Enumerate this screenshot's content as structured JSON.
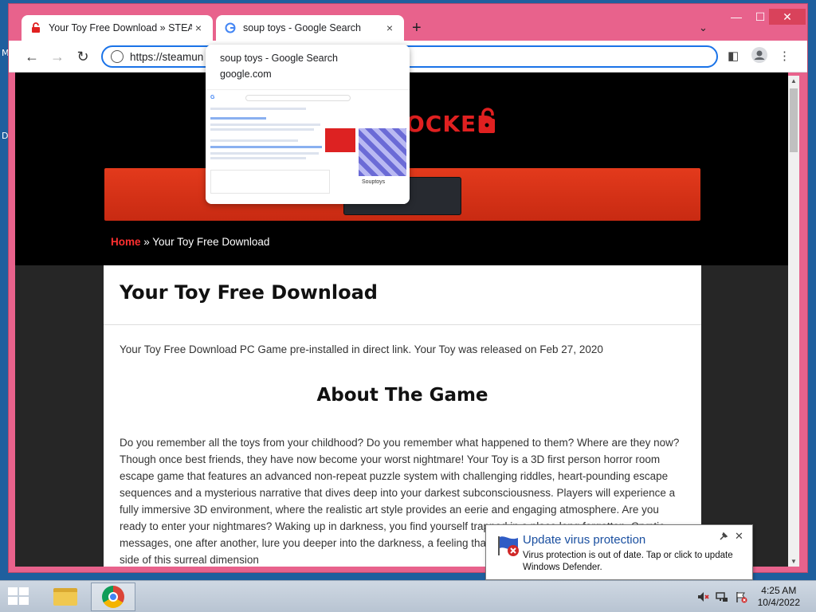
{
  "desktop": {
    "edge_labels": [
      "M",
      "D"
    ]
  },
  "tabs": [
    {
      "title": "Your Toy Free Download » STEAM",
      "close": "×"
    },
    {
      "title": "soup toys - Google Search",
      "close": "×"
    }
  ],
  "tabstrip": {
    "new_tab": "+",
    "tab_search": "⌄"
  },
  "window_controls": {
    "minimize": "—",
    "maximize": "☐",
    "close": "✕"
  },
  "toolbar": {
    "back": "←",
    "forward": "→",
    "reload": "↻",
    "url": "https://steamun",
    "reading_mode": "◧",
    "menu": "⋮"
  },
  "hover_card": {
    "title": "soup toys - Google Search",
    "domain": "google.com",
    "thumb_caption": "Souptoys"
  },
  "site": {
    "logo_text": "OCKED",
    "breadcrumb_home": "Home",
    "breadcrumb_sep": " » ",
    "breadcrumb_current": "Your Toy Free Download"
  },
  "post": {
    "title": "Your Toy Free Download",
    "intro": "Your Toy Free Download PC Game pre-installed in direct link. Your Toy was released on Feb 27, 2020",
    "section_heading": "About The Game",
    "body": "Do you remember all the toys from your childhood? Do you remember what happened to them? Where are they now? Though once best friends, they have now become your worst nightmare! Your Toy is a 3D first person horror room escape game that features an advanced non-repeat puzzle system with challenging riddles, heart-pounding escape sequences and a mysterious narrative that dives deep into your darkest subconsciousness. Players will experience a fully immersive 3D environment, where the realistic art style provides an eerie and engaging atmosphere. Are you ready to enter your nightmares?  Waking up in darkness, you find yourself trapped in a place long forgotten. Cryptic messages, one after another, lure you deeper into the darkness, a feeling that someone is watching you from the other side of this surreal dimension"
  },
  "notification": {
    "title": "Update virus protection",
    "message": "Virus protection is out of date. Tap or click to update Windows Defender.",
    "close": "✕"
  },
  "clock": {
    "time": "4:25 AM",
    "date": "10/4/2022"
  },
  "colors": {
    "window_frame": "#e8628c",
    "accent_red": "#e02020",
    "omnibox_focus": "#1a73e8"
  }
}
